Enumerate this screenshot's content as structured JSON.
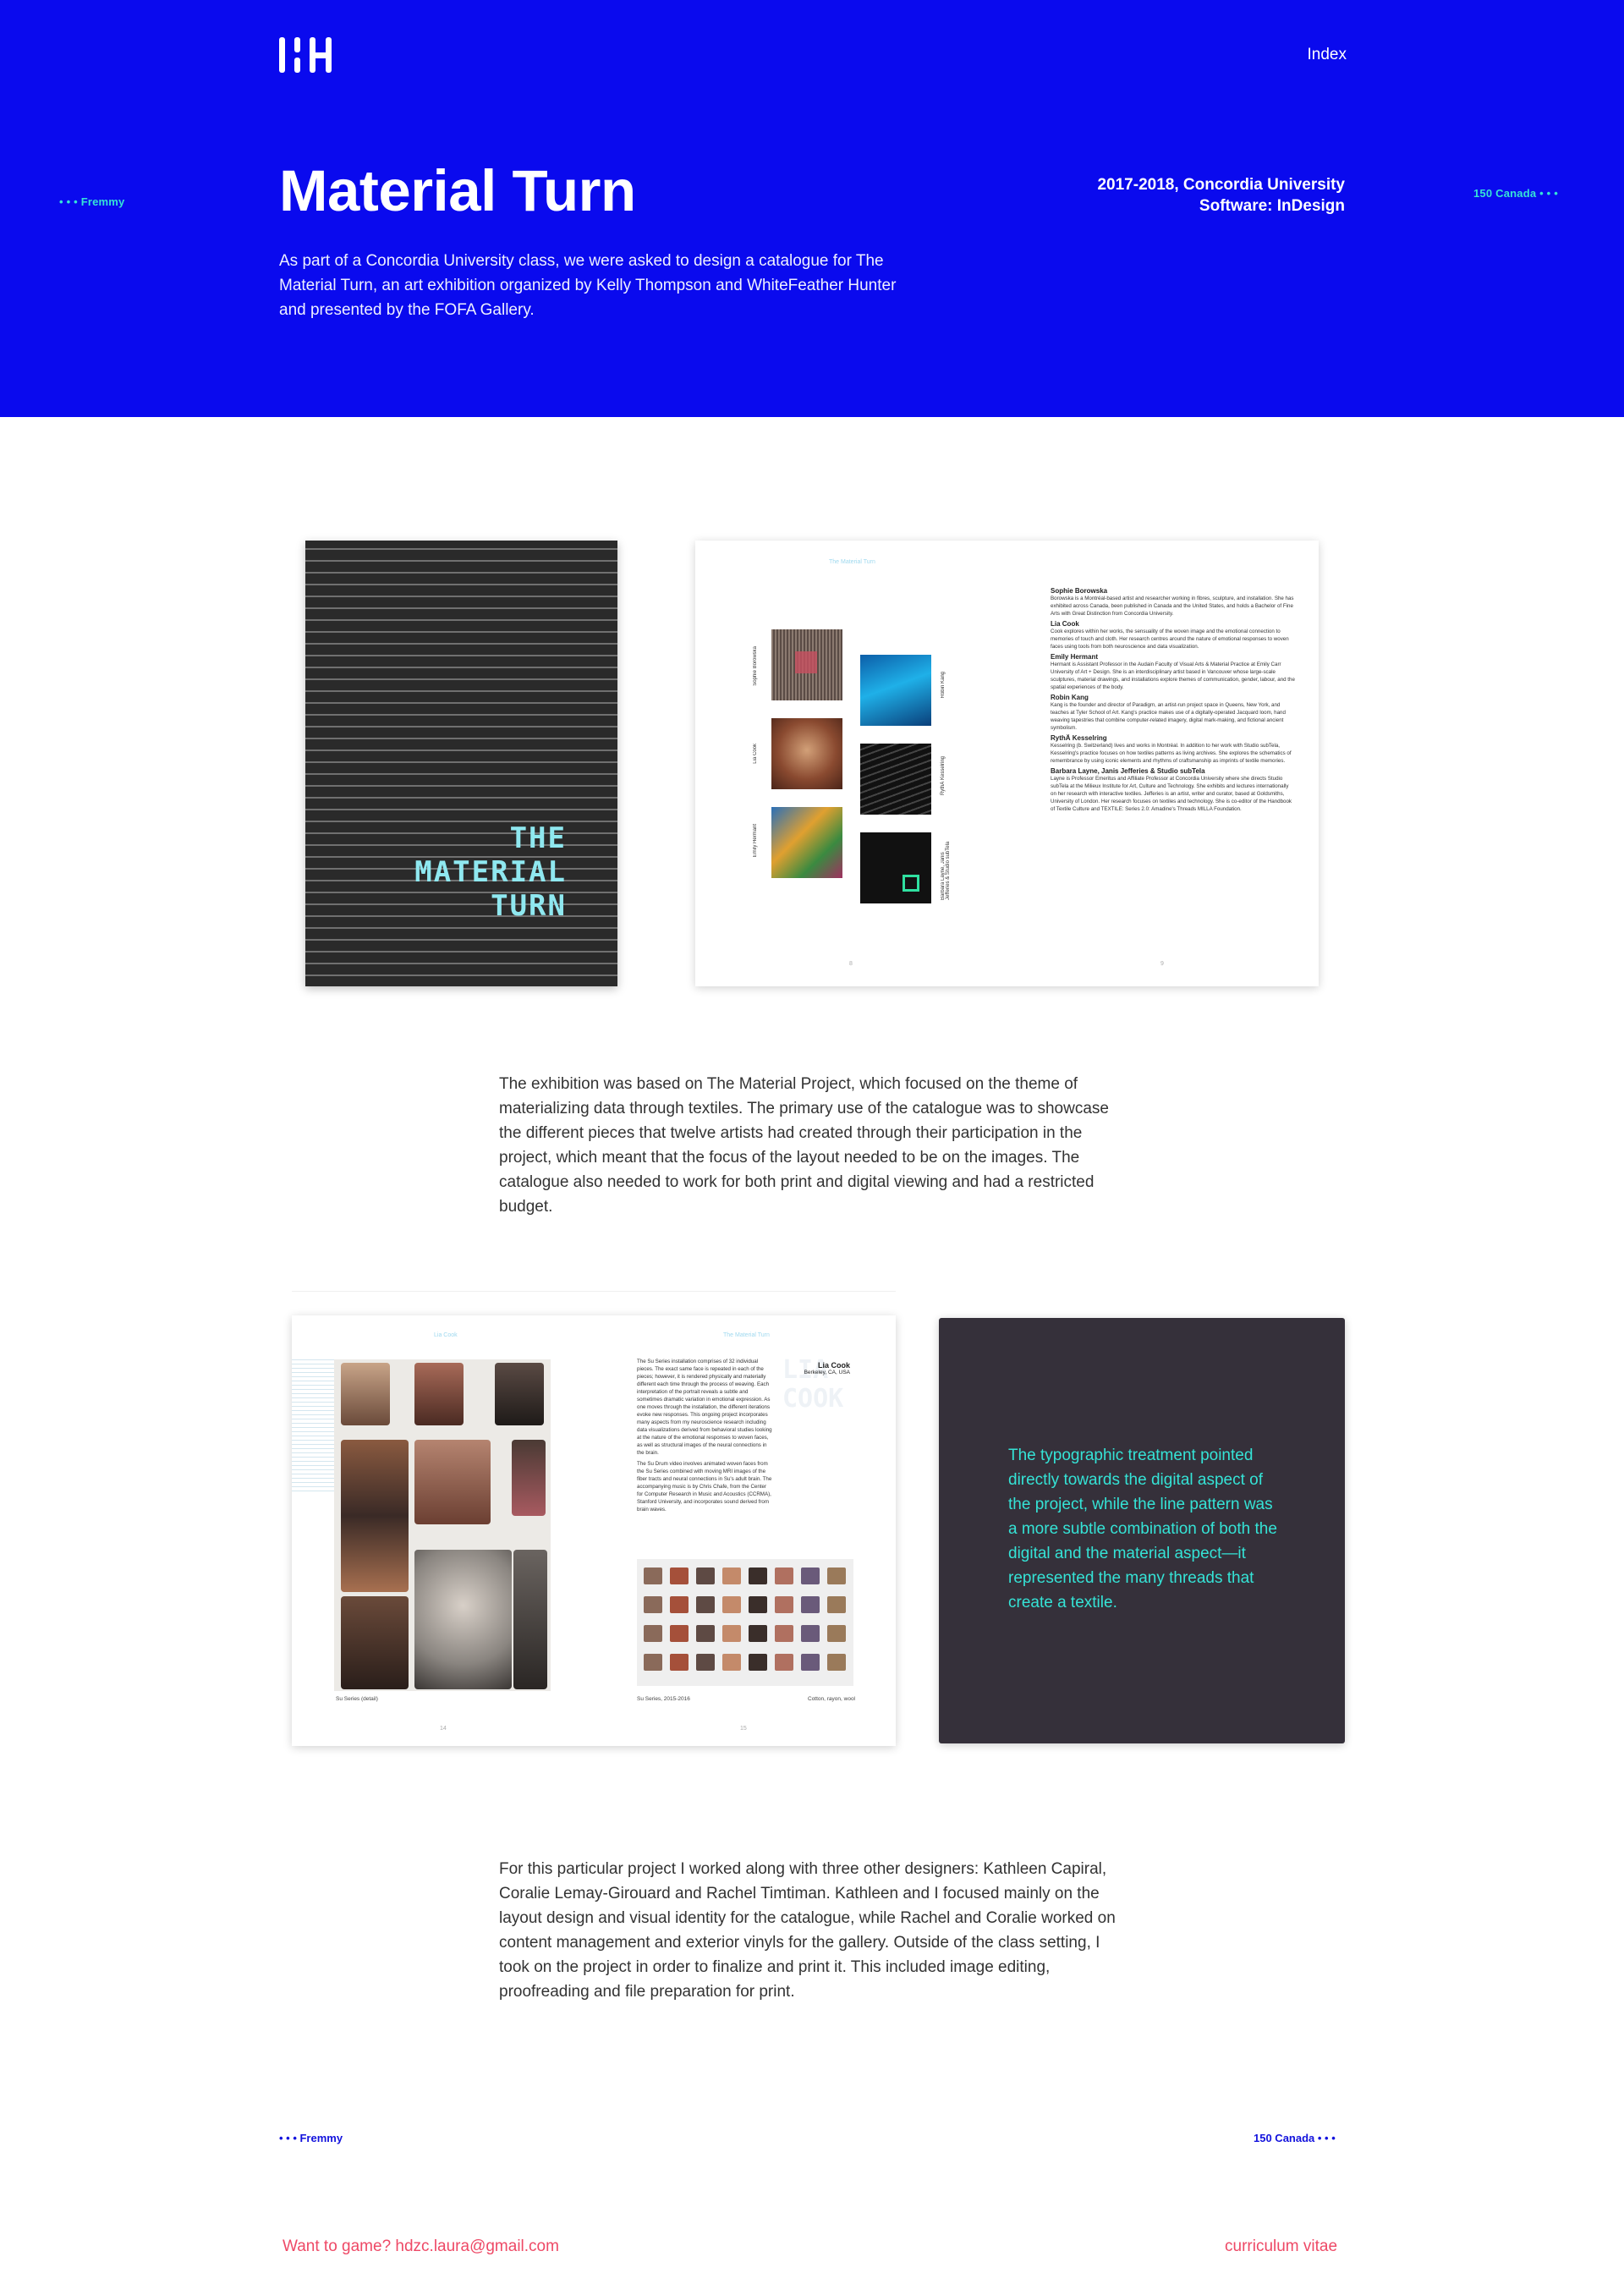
{
  "header": {
    "nav_index": "Index",
    "side_left": "• • • Fremmy",
    "side_right": "150 Canada • • •"
  },
  "hero": {
    "title": "Material Turn",
    "meta_line1": "2017-2018, Concordia University",
    "meta_line2": "Software: InDesign",
    "description": "As part of a Concordia University class, we were asked to design a catalogue for The Material Turn, an art exhibition organized by Kelly Thompson and WhiteFeather Hunter and presented by the FOFA Gallery."
  },
  "catalogue_cover": {
    "title_lines": [
      "THE",
      "MATERIAL",
      "TURN"
    ]
  },
  "spread_a": {
    "running_head": "The Material Turn",
    "page_left": "8",
    "page_right": "9",
    "thumb_labels": [
      "Sophie Borowska",
      "Lia Cook",
      "Emily Hermant",
      "Robin Kang",
      "RythÄ Kesselring",
      "Barbara Layne, Janis Jefferies & Studio subTela"
    ],
    "bios": [
      {
        "name": "Sophie Borowska",
        "text": "Borowska is a Montréal-based artist and researcher working in fibres, sculpture, and installation. She has exhibited across Canada, been published in Canada and the United States, and holds a Bachelor of Fine Arts with Great Distinction from Concordia University."
      },
      {
        "name": "Lia Cook",
        "text": "Cook explores within her works, the sensuality of the woven image and the emotional connection to memories of touch and cloth. Her research centres around the nature of emotional responses to woven faces using tools from both neuroscience and data visualization."
      },
      {
        "name": "Emily Hermant",
        "text": "Hermant is Assistant Professor in the Audain Faculty of Visual Arts & Material Practice at Emily Carr University of Art + Design. She is an interdisciplinary artist based in Vancouver whose large-scale sculptures, material drawings, and installations explore themes of communication, gender, labour, and the spatial experiences of the body."
      },
      {
        "name": "Robin Kang",
        "text": "Kang is the founder and director of Paradigm, an artist-run project space in Queens, New York, and teaches at Tyler School of Art. Kang's practice makes use of a digitally-operated Jacquard loom, hand weaving tapestries that combine computer-related imagery, digital mark-making, and fictional ancient symbolism."
      },
      {
        "name": "RythÄ Kesselring",
        "text": "Kesselring (b. Switzerland) lives and works in Montréal. In addition to her work with Studio subTela, Kesselring's practice focuses on how textiles patterns as living archives. She explores the schematics of remembrance by using iconic elements and rhythms of craftsmanship as imprints of textile memories."
      },
      {
        "name": "Barbara Layne, Janis Jefferies & Studio subTela",
        "text": "Layne is Professor Emeritus and Affiliate Professor at Concordia University where she directs Studio subTela at the Milieux Institute for Art, Culture and Technology. She exhibits and lectures internationally on her research with interactive textiles. Jefferies is an artist, writer and curator, based at Goldsmiths, University of London. Her research focuses on textiles and technology. She is co-editor of the Handbook of Textile Culture and TEXTILE: Series 2.0: Amadine's Threads MILLA Foundation."
      }
    ]
  },
  "paragraph_1": "The exhibition was based on The Material Project, which focused on the theme of materializing data through textiles. The primary use of the catalogue was to showcase the different pieces that twelve artists had created through their participation in the project, which meant that the focus of the layout needed to be on the images. The catalogue also needed to work for both print and digital viewing and had a restricted budget.",
  "spread_b": {
    "running_head_left": "Lia Cook",
    "running_head_right": "The Material Turn",
    "page_left": "14",
    "page_right": "15",
    "artist_name": "Lia Cook",
    "artist_location": "Berkeley, CA, USA",
    "artist_ghost": "LIA COOK",
    "text_1": "The Su Series installation comprises of 32 individual pieces. The exact same face is repeated in each of the pieces; however, it is rendered physically and materially different each time through the process of weaving. Each interpretation of the portrait reveals a subtle and sometimes dramatic variation in emotional expression. As one moves through the installation, the different iterations evoke new responses. This ongoing project incorporates many aspects from my neuroscience research including data visualizations derived from behavioral studies looking at the nature of the emotional responses to woven faces, as well as structural images of the neural connections in the brain.",
    "text_2": "The Su Drum video involves animated woven faces from the Su Series combined with moving MRI images of the fiber tracts and neural connections in Su's adult brain. The accompanying music is by Chris Chafe, from the Center for Computer Research in Music and Acoustics (CCRMA), Stanford University, and incorporates sound derived from brain waves.",
    "caption_left": "Su Series (detail)",
    "caption_right_1": "Su Series, 2015-2016",
    "caption_right_2": "Cotton, rayon, wool"
  },
  "quote": "The typographic treatment pointed directly towards the digital aspect of the project, while the line pattern was a more subtle combination of both the digital and the material aspect—it represented the many threads that create a textile.",
  "paragraph_2": "For this particular project I worked along with three other designers: Kathleen Capiral, Coralie Lemay-Girouard and Rachel Timtiman. Kathleen and I focused mainly on the layout design and visual identity for the catalogue, while Rachel and Coralie worked on content management and exterior vinyls for the gallery. Outside of the class setting, I took on the project in order to finalize and print it. This included image editing, proofreading and file preparation for print.",
  "footer": {
    "tag_left": "• • • Fremmy",
    "tag_right": "150 Canada • • •",
    "contact": "Want to game? hdzc.laura@gmail.com",
    "cv": "curriculum vitae"
  },
  "colors": {
    "hero_blue": "#0a0aee",
    "accent_cyan": "#35e3d6",
    "footer_pink": "#ee4966",
    "dark_card": "#35303a"
  }
}
